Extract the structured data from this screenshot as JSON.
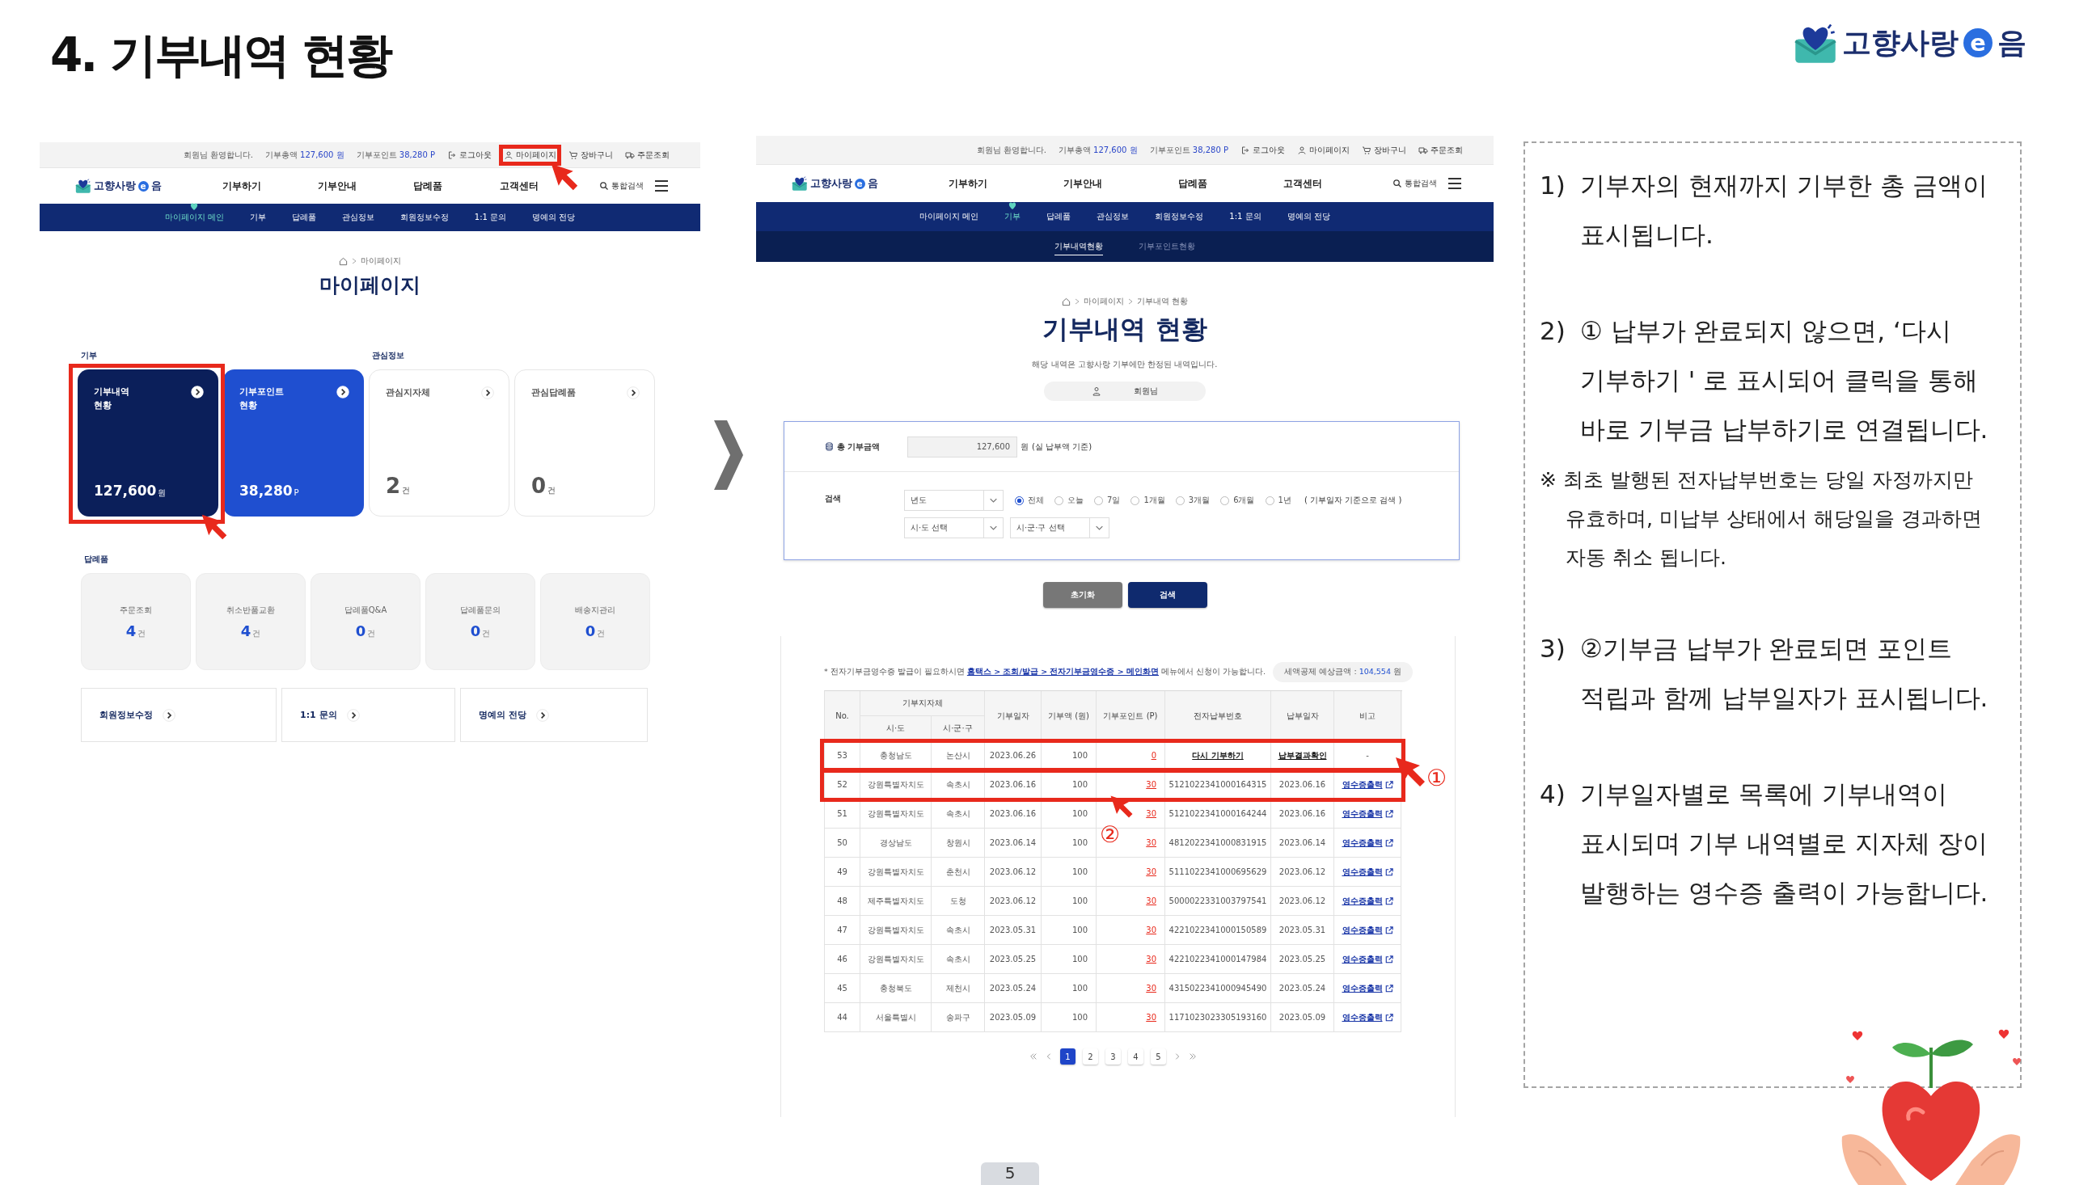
{
  "slide_title": "4. 기부내역 현황",
  "brand_logo": [
    {
      "kind": "text",
      "text": "고향사랑"
    },
    {
      "kind": "circle",
      "text": "e"
    },
    {
      "kind": "text",
      "text": "음"
    }
  ],
  "mypage_screen": {
    "util_bar": {
      "welcome": "회원님 환영합니다.",
      "stats": [
        {
          "label": "기부총액",
          "value": "127,600 원"
        },
        {
          "label": "기부포인트",
          "value": "38,280 P"
        }
      ],
      "links": [
        {
          "label": "로그아웃",
          "highlighted": false
        },
        {
          "label": "마이페이지",
          "highlighted": true
        },
        {
          "label": "장바구니",
          "highlighted": false
        },
        {
          "label": "주문조회",
          "highlighted": false
        }
      ]
    },
    "logo": [
      {
        "kind": "text",
        "text": "고향사랑"
      },
      {
        "kind": "circle",
        "text": "e"
      },
      {
        "kind": "text",
        "text": "음"
      }
    ],
    "main_menu": [
      "기부하기",
      "기부안내",
      "답례품",
      "고객센터"
    ],
    "search": "통합검색",
    "sub_menu": [
      {
        "label": "마이페이지 메인",
        "selected": true
      },
      {
        "label": "기부",
        "selected": false
      },
      {
        "label": "답례품",
        "selected": false
      },
      {
        "label": "관심정보",
        "selected": false
      },
      {
        "label": "회원정보수정",
        "selected": false
      },
      {
        "label": "1:1 문의",
        "selected": false
      },
      {
        "label": "명예의 전당",
        "selected": false
      }
    ],
    "breadcrumb": [
      "마이페이지"
    ],
    "title": "마이페이지",
    "donation_section": {
      "label": "기부",
      "cards": [
        {
          "kind": "dark",
          "title": "기부내역 현황",
          "value": "127,600",
          "unit": "원",
          "highlighted": true
        },
        {
          "kind": "blue",
          "title": "기부포인트 현황",
          "value": "38,280",
          "unit": "P",
          "highlighted": false
        }
      ]
    },
    "interest_section": {
      "label": "관심정보",
      "cards": [
        {
          "kind": "plain",
          "title": "관심지자체",
          "value": "2",
          "unit": "건",
          "highlighted": false
        },
        {
          "kind": "plain",
          "title": "관심답례품",
          "value": "0",
          "unit": "건",
          "highlighted": false
        }
      ]
    },
    "gift_section": {
      "label": "답례품",
      "stats": [
        {
          "label": "주문조회",
          "value": "4",
          "unit": "건"
        },
        {
          "label": "취소반품교환",
          "value": "4",
          "unit": "건"
        },
        {
          "label": "답례품Q&A",
          "value": "0",
          "unit": "건"
        },
        {
          "label": "답례품문의",
          "value": "0",
          "unit": "건"
        },
        {
          "label": "배송지관리",
          "value": "0",
          "unit": "건"
        }
      ]
    },
    "quick_links": [
      "회원정보수정",
      "1:1 문의",
      "명예의 전당"
    ]
  },
  "history_screen": {
    "util_bar": {
      "welcome": "회원님 환영합니다.",
      "stats": [
        {
          "label": "기부총액",
          "value": "127,600 원"
        },
        {
          "label": "기부포인트",
          "value": "38,280 P"
        }
      ],
      "links": [
        {
          "label": "로그아웃",
          "highlighted": false
        },
        {
          "label": "마이페이지",
          "highlighted": false
        },
        {
          "label": "장바구니",
          "highlighted": false
        },
        {
          "label": "주문조회",
          "highlighted": false
        }
      ]
    },
    "logo": [
      {
        "kind": "text",
        "text": "고향사랑"
      },
      {
        "kind": "circle",
        "text": "e"
      },
      {
        "kind": "text",
        "text": "음"
      }
    ],
    "main_menu": [
      "기부하기",
      "기부안내",
      "답례품",
      "고객센터"
    ],
    "search": "통합검색",
    "sub_menu": [
      {
        "label": "마이페이지 메인",
        "selected": false
      },
      {
        "label": "기부",
        "selected": true
      },
      {
        "label": "답례품",
        "selected": false
      },
      {
        "label": "관심정보",
        "selected": false
      },
      {
        "label": "회원정보수정",
        "selected": false
      },
      {
        "label": "1:1 문의",
        "selected": false
      },
      {
        "label": "명예의 전당",
        "selected": false
      }
    ],
    "tabs": [
      {
        "label": "기부내역현황",
        "selected": true
      },
      {
        "label": "기부포인트현황",
        "selected": false
      }
    ],
    "breadcrumb": [
      "마이페이지",
      "기부내역 현황"
    ],
    "title": "기부내역 현황",
    "description": "해당 내역은 고향사랑 기부에만 한정된 내역입니다.",
    "member": "회원님",
    "summary": {
      "label": "총 기부금액",
      "value": "127,600",
      "unit": "원",
      "note": "(실 납부액 기준)"
    },
    "search_form": {
      "label": "검색",
      "year_select": "년도",
      "periods": [
        {
          "label": "전체",
          "selected": true
        },
        {
          "label": "오늘",
          "selected": false
        },
        {
          "label": "7일",
          "selected": false
        },
        {
          "label": "1개월",
          "selected": false
        },
        {
          "label": "3개월",
          "selected": false
        },
        {
          "label": "6개월",
          "selected": false
        },
        {
          "label": "1년",
          "selected": false
        }
      ],
      "period_note": "( 기부일자 기준으로 검색 )",
      "region_selects": [
        "시·도 선택",
        "시·군·구 선택"
      ]
    },
    "buttons": [
      {
        "label": "초기화",
        "kind": "reset"
      },
      {
        "label": "검색",
        "kind": "submit"
      }
    ],
    "notice": {
      "before": "* 전자기부금영수증 발급이 필요하시면",
      "link": "홈택스 > 조회/발급 > 전자기부금영수증 > 메인화면",
      "after": "메뉴에서 신청이 가능합니다."
    },
    "tax_estimate": {
      "label": "세액공제 예상금액 :",
      "value": "104,554",
      "unit": "원"
    },
    "table": {
      "group_header": "기부지자체",
      "columns": [
        "No.",
        "시·도",
        "시·군·구",
        "기부일자",
        "기부액 (원)",
        "기부포인트 (P)",
        "전자납부번호",
        "납부일자",
        "비고"
      ],
      "rows": [
        {
          "kind": "unpaid",
          "no": "53",
          "province": "충청남도",
          "city": "논산시",
          "date": "2023.06.26",
          "amount": "100",
          "points": "0",
          "payment_no": "다시 기부하기",
          "paid_date": "납부결과확인",
          "note": "-",
          "highlighted": true,
          "marker": "①"
        },
        {
          "kind": "paid",
          "no": "52",
          "province": "강원특별자치도",
          "city": "속초시",
          "date": "2023.06.16",
          "amount": "100",
          "points": "30",
          "payment_no": "5121022341000164315",
          "paid_date": "2023.06.16",
          "note": "영수증출력",
          "highlighted": true,
          "marker": "②"
        },
        {
          "kind": "paid",
          "no": "51",
          "province": "강원특별자치도",
          "city": "속초시",
          "date": "2023.06.16",
          "amount": "100",
          "points": "30",
          "payment_no": "5121022341000164244",
          "paid_date": "2023.06.16",
          "note": "영수증출력",
          "highlighted": false
        },
        {
          "kind": "paid",
          "no": "50",
          "province": "경상남도",
          "city": "창원시",
          "date": "2023.06.14",
          "amount": "100",
          "points": "30",
          "payment_no": "4812022341000831915",
          "paid_date": "2023.06.14",
          "note": "영수증출력",
          "highlighted": false
        },
        {
          "kind": "paid",
          "no": "49",
          "province": "강원특별자치도",
          "city": "춘천시",
          "date": "2023.06.12",
          "amount": "100",
          "points": "30",
          "payment_no": "5111022341000695629",
          "paid_date": "2023.06.12",
          "note": "영수증출력",
          "highlighted": false
        },
        {
          "kind": "paid",
          "no": "48",
          "province": "제주특별자치도",
          "city": "도청",
          "date": "2023.06.12",
          "amount": "100",
          "points": "30",
          "payment_no": "5000022331003797541",
          "paid_date": "2023.06.12",
          "note": "영수증출력",
          "highlighted": false
        },
        {
          "kind": "paid",
          "no": "47",
          "province": "강원특별자치도",
          "city": "속초시",
          "date": "2023.05.31",
          "amount": "100",
          "points": "30",
          "payment_no": "4221022341000150589",
          "paid_date": "2023.05.31",
          "note": "영수증출력",
          "highlighted": false
        },
        {
          "kind": "paid",
          "no": "46",
          "province": "강원특별자치도",
          "city": "속초시",
          "date": "2023.05.25",
          "amount": "100",
          "points": "30",
          "payment_no": "4221022341000147984",
          "paid_date": "2023.05.25",
          "note": "영수증출력",
          "highlighted": false
        },
        {
          "kind": "paid",
          "no": "45",
          "province": "충청북도",
          "city": "제천시",
          "date": "2023.05.24",
          "amount": "100",
          "points": "30",
          "payment_no": "4315022341000945490",
          "paid_date": "2023.05.24",
          "note": "영수증출력",
          "highlighted": false
        },
        {
          "kind": "paid",
          "no": "44",
          "province": "서울특별시",
          "city": "송파구",
          "date": "2023.05.09",
          "amount": "100",
          "points": "30",
          "payment_no": "1171023023305193160",
          "paid_date": "2023.05.09",
          "note": "영수증출력",
          "highlighted": false
        }
      ]
    },
    "pagination": [
      {
        "label": "1",
        "selected": true
      },
      {
        "label": "2",
        "selected": false
      },
      {
        "label": "3",
        "selected": false
      },
      {
        "label": "4",
        "selected": false
      },
      {
        "label": "5",
        "selected": false
      }
    ]
  },
  "guide": [
    {
      "kind": "numbered",
      "number": "1)",
      "text": "기부자의 현재까지 기부한 총 금액이 표시됩니다."
    },
    {
      "kind": "numbered",
      "number": "2)",
      "text": "① 납부가 완료되지 않으면, ‘다시 기부하기 ' 로 표시되어 클릭을 통해 바로 기부금 납부하기로 연결됩니다."
    },
    {
      "kind": "note",
      "text": "※ 최초 발행된 전자납부번호는 당일 자정까지만 유효하며, 미납부 상태에서 해당일을 경과하면 자동 취소 됩니다."
    },
    {
      "kind": "numbered",
      "number": "3)",
      "text": "②기부금 납부가 완료되면 포인트 적립과 함께 납부일자가 표시됩니다."
    },
    {
      "kind": "numbered",
      "number": "4)",
      "text": "기부일자별로 목록에 기부내역이 표시되며 기부 내역별로 지자체 장이 발행하는 영수증 출력이 가능합니다."
    }
  ],
  "page_number": "5"
}
